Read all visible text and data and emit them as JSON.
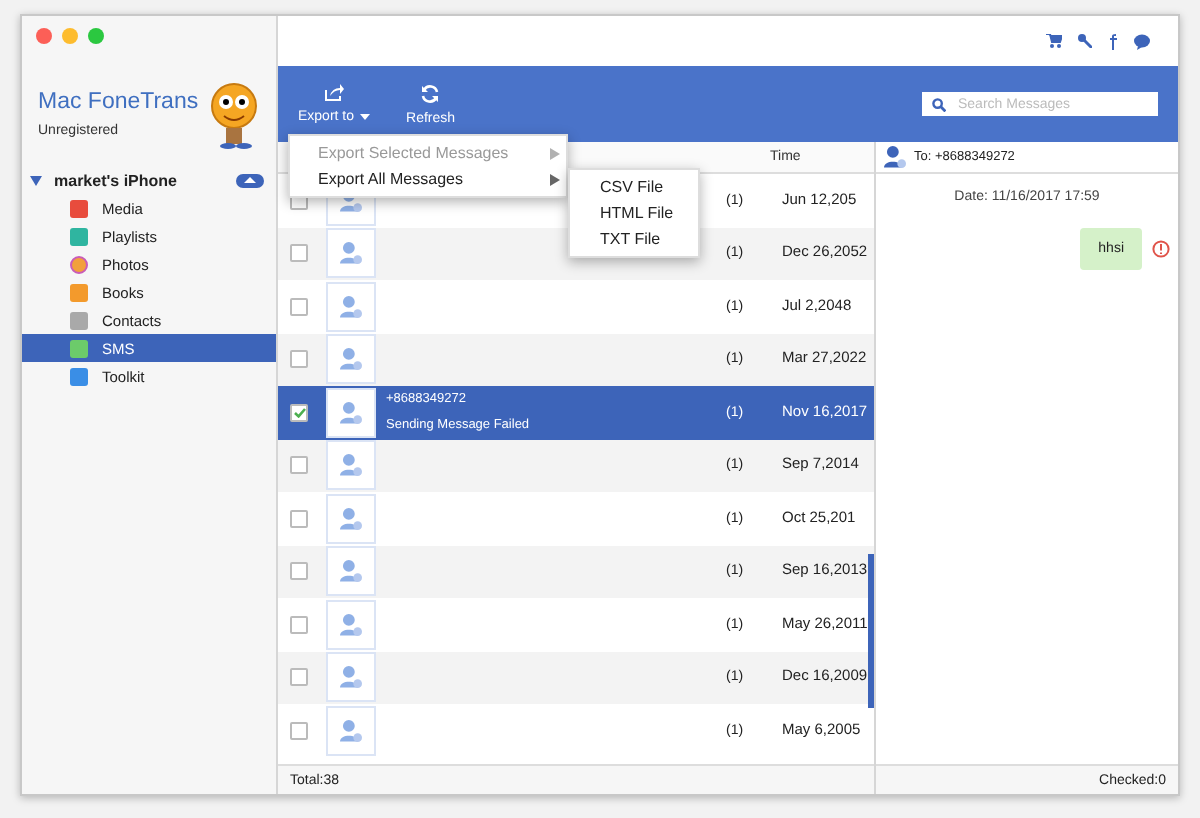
{
  "app": {
    "name": "Mac FoneTrans",
    "status": "Unregistered"
  },
  "device": {
    "name": "market's iPhone",
    "expanded": true
  },
  "sidebar": {
    "items": [
      {
        "label": "Media",
        "selected": false
      },
      {
        "label": "Playlists",
        "selected": false
      },
      {
        "label": "Photos",
        "selected": false
      },
      {
        "label": "Books",
        "selected": false
      },
      {
        "label": "Contacts",
        "selected": false
      },
      {
        "label": "SMS",
        "selected": true
      },
      {
        "label": "Toolkit",
        "selected": false
      }
    ]
  },
  "toolbar": {
    "export": {
      "label": "Export to"
    },
    "refresh": {
      "label": "Refresh"
    },
    "search": {
      "placeholder": "Search Messages"
    }
  },
  "export_menu": {
    "items": [
      {
        "label": "Export Selected Messages",
        "disabled": true
      },
      {
        "label": "Export All Messages",
        "disabled": false,
        "submenu": [
          "CSV File",
          "HTML File",
          "TXT File"
        ]
      }
    ]
  },
  "table": {
    "time_heading": "Time",
    "rows": [
      {
        "checked": false,
        "selected": false,
        "count": "(1)",
        "date": "Jun 12,205"
      },
      {
        "checked": false,
        "selected": false,
        "count": "(1)",
        "date": "Dec 26,2052"
      },
      {
        "checked": false,
        "selected": false,
        "count": "(1)",
        "date": "Jul 2,2048"
      },
      {
        "checked": false,
        "selected": false,
        "count": "(1)",
        "date": "Mar 27,2022"
      },
      {
        "checked": true,
        "selected": true,
        "contact": "+8688349272",
        "preview": "Sending Message Failed",
        "count": "(1)",
        "date": "Nov 16,2017"
      },
      {
        "checked": false,
        "selected": false,
        "count": "(1)",
        "date": "Sep 7,2014"
      },
      {
        "checked": false,
        "selected": false,
        "count": "(1)",
        "date": "Oct 25,201"
      },
      {
        "checked": false,
        "selected": false,
        "count": "(1)",
        "date": "Sep 16,2013"
      },
      {
        "checked": false,
        "selected": false,
        "count": "(1)",
        "date": "May 26,2011"
      },
      {
        "checked": false,
        "selected": false,
        "count": "(1)",
        "date": "Dec 16,2009"
      },
      {
        "checked": false,
        "selected": false,
        "count": "(1)",
        "date": "May 6,2005"
      }
    ]
  },
  "conversation": {
    "to": "To: +8688349272",
    "date": "Date: 11/16/2017 17:59",
    "messages": [
      {
        "text": "hhsi",
        "failed": true
      }
    ]
  },
  "status_bar": {
    "total": "Total:38",
    "checked": "Checked:0"
  }
}
